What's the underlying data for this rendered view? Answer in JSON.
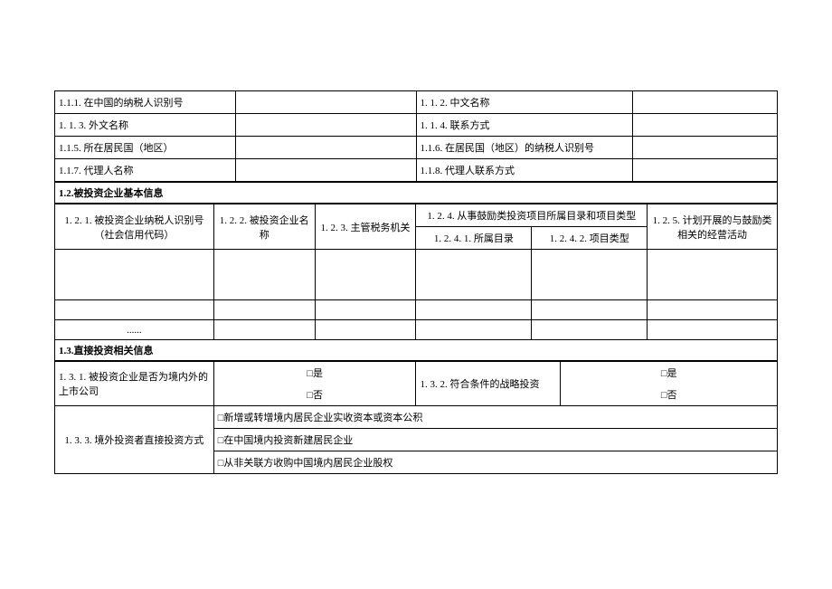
{
  "s1": {
    "r1a": "1.1.1. 在中国的纳税人识别号",
    "r1b": "1. 1. 2. 中文名称",
    "r2a": "1. 1. 3. 外文名称",
    "r2b": "1. 1. 4. 联系方式",
    "r3a": "1.1.5. 所在居民国（地区）",
    "r3b": "1.1.6. 在居民国（地区）的纳税人识别号",
    "r4a": "1.1.7. 代理人名称",
    "r4b": "1.1.8. 代理人联系方式"
  },
  "s2": {
    "title": "1.2.被投资企业基本信息",
    "h1": "1. 2. 1. 被投资企业纳税人识别号（社会信用代码）",
    "h2": "1. 2. 2. 被投资企业名称",
    "h3": "1. 2. 3. 主管税务机关",
    "h4": "1. 2. 4. 从事鼓励类投资项目所属目录和项目类型",
    "h4a": "1. 2. 4. 1. 所属目录",
    "h4b": "1. 2. 4. 2. 项目类型",
    "h5": "1. 2. 5. 计划开展的与鼓励类相关的经营活动",
    "ellipsis": "......"
  },
  "s3": {
    "title": "1.3.直接投资相关信息",
    "r1a": "1. 3. 1. 被投资企业是否为境内外的上市公司",
    "r1b": "1. 3. 2. 符合条件的战略投资",
    "yes": "□是",
    "no": "□否",
    "r2": "1. 3. 3. 境外投资者直接投资方式",
    "opt1": "□新增或转增境内居民企业实收资本或资本公积",
    "opt2": "□在中国境内投资新建居民企业",
    "opt3": "□从非关联方收购中国境内居民企业股权"
  }
}
